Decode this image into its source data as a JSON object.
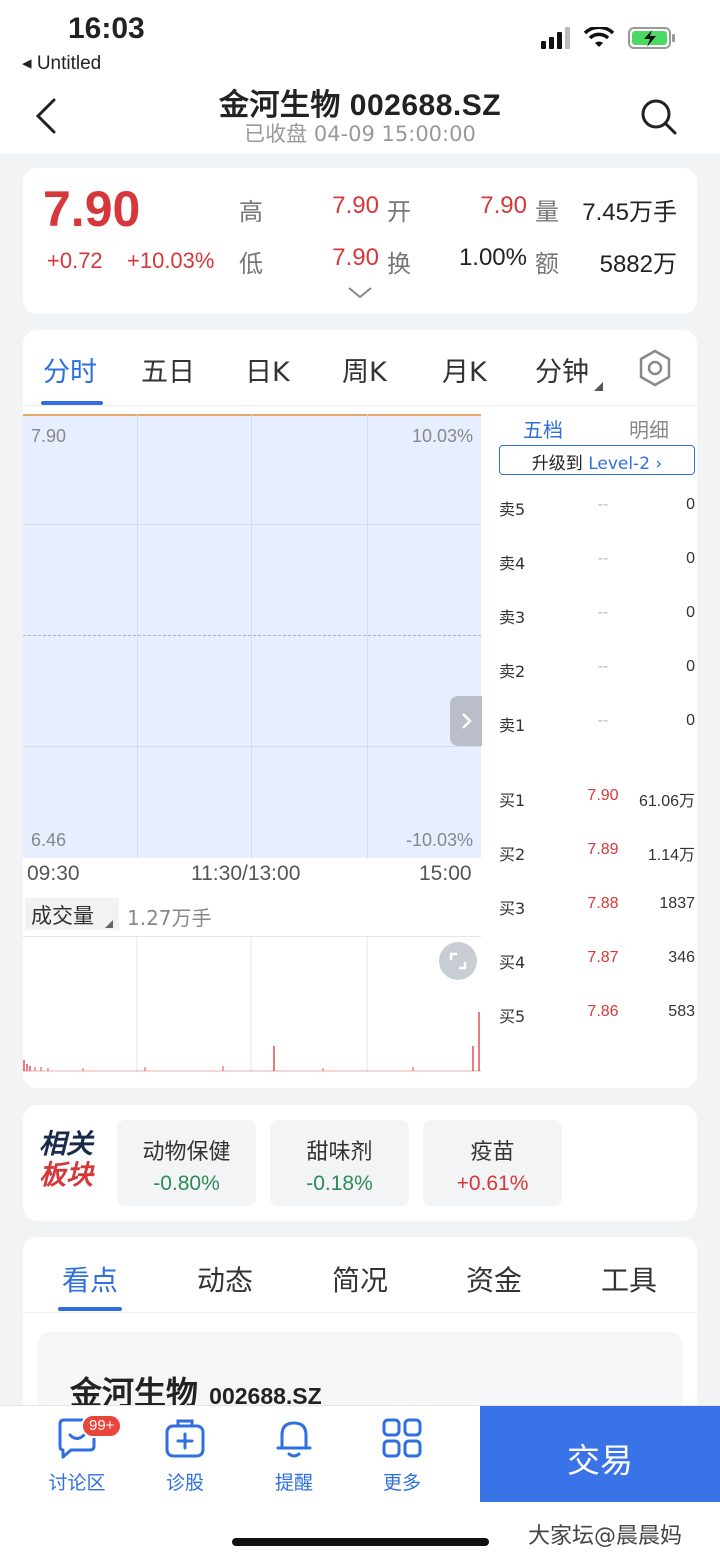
{
  "status_bar": {
    "time": "16:03",
    "back_app": "◂ Untitled"
  },
  "header": {
    "title": "金河生物 002688.SZ",
    "subtitle": "已收盘 04-09 15:00:00"
  },
  "quote": {
    "price": "7.90",
    "change": "+0.72",
    "change_pct": "+10.03%",
    "high_label": "高",
    "high": "7.90",
    "open_label": "开",
    "open": "7.90",
    "volume_label": "量",
    "volume": "7.45万手",
    "low_label": "低",
    "low": "7.90",
    "turnover_label": "换",
    "turnover": "1.00%",
    "amount_label": "额",
    "amount": "5882万"
  },
  "chart_tabs": [
    "分时",
    "五日",
    "日K",
    "周K",
    "月K",
    "分钟"
  ],
  "intraday": {
    "price_high": "7.90",
    "price_low": "6.46",
    "pct_high": "10.03%",
    "pct_low": "-10.03%",
    "times": [
      "09:30",
      "11:30/13:00",
      "15:00"
    ],
    "volume_label": "成交量",
    "volume_total": "1.27万手"
  },
  "depth": {
    "tab_five": "五档",
    "tab_detail": "明细",
    "upgrade_prefix": "升级到 ",
    "upgrade_level": "Level-2",
    "asks": [
      {
        "label": "卖5",
        "price": "--",
        "qty": "0"
      },
      {
        "label": "卖4",
        "price": "--",
        "qty": "0"
      },
      {
        "label": "卖3",
        "price": "--",
        "qty": "0"
      },
      {
        "label": "卖2",
        "price": "--",
        "qty": "0"
      },
      {
        "label": "卖1",
        "price": "--",
        "qty": "0"
      }
    ],
    "bids": [
      {
        "label": "买1",
        "price": "7.90",
        "qty": "61.06万"
      },
      {
        "label": "买2",
        "price": "7.89",
        "qty": "1.14万"
      },
      {
        "label": "买3",
        "price": "7.88",
        "qty": "1837"
      },
      {
        "label": "买4",
        "price": "7.87",
        "qty": "346"
      },
      {
        "label": "买5",
        "price": "7.86",
        "qty": "583"
      }
    ]
  },
  "sectors": {
    "title_line1": "相关",
    "title_line2": "板块",
    "items": [
      {
        "name": "动物保健",
        "pct": "-0.80%"
      },
      {
        "name": "甜味剂",
        "pct": "-0.18%"
      },
      {
        "name": "疫苗",
        "pct": "+0.61%"
      }
    ]
  },
  "info_tabs": [
    "看点",
    "动态",
    "简况",
    "资金",
    "工具"
  ],
  "info": {
    "name": "金河生物",
    "code": "002688.SZ"
  },
  "bottom_bar": {
    "discuss": "讨论区",
    "badge": "99+",
    "diagnose": "诊股",
    "remind": "提醒",
    "more": "更多",
    "trade": "交易"
  },
  "watermark": "大家坛@晨晨妈"
}
